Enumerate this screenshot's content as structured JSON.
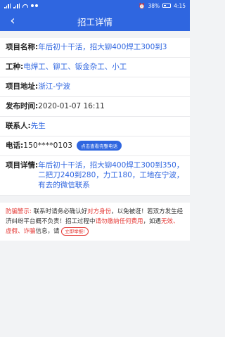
{
  "status_bar": {
    "battery": "38%",
    "time": "4:15"
  },
  "header": {
    "title": "招工详情",
    "back_icon": "chevron-left-icon"
  },
  "details": {
    "project_name": {
      "label": "项目名称:",
      "value": "年后初十干活，招大铆400焊工300到3"
    },
    "trade": {
      "label": "工种:",
      "value": "电焊工、铆工、钣金杂工、小工"
    },
    "address": {
      "label": "项目地址:",
      "value": "浙江-宁波"
    },
    "publish_time": {
      "label": "发布时间:",
      "value": "2020-01-07 16:11"
    },
    "contact": {
      "label": "联系人:",
      "value": "先生"
    },
    "phone": {
      "label": "电话:",
      "value": "150****0103",
      "button": "点击查看完整电话"
    },
    "project_detail": {
      "label": "项目详情:",
      "value": "年后初十干活，招大铆400焊工300到350，二把刀240到280，力工180，工地在宁波，有去的微信联系"
    }
  },
  "warning": {
    "prefix": "防骗警示:",
    "t1": "联系时请务必确认好",
    "t2": "对方身份",
    "t3": "，以免被诳！若双方发生经济纠纷平台概不负责！招工过程中",
    "t4": "请勿缴纳任何费用",
    "t5": "，如遇",
    "t6": "无效、虚假、诈骗",
    "t7": "信息，请",
    "report": "立即举报!"
  }
}
